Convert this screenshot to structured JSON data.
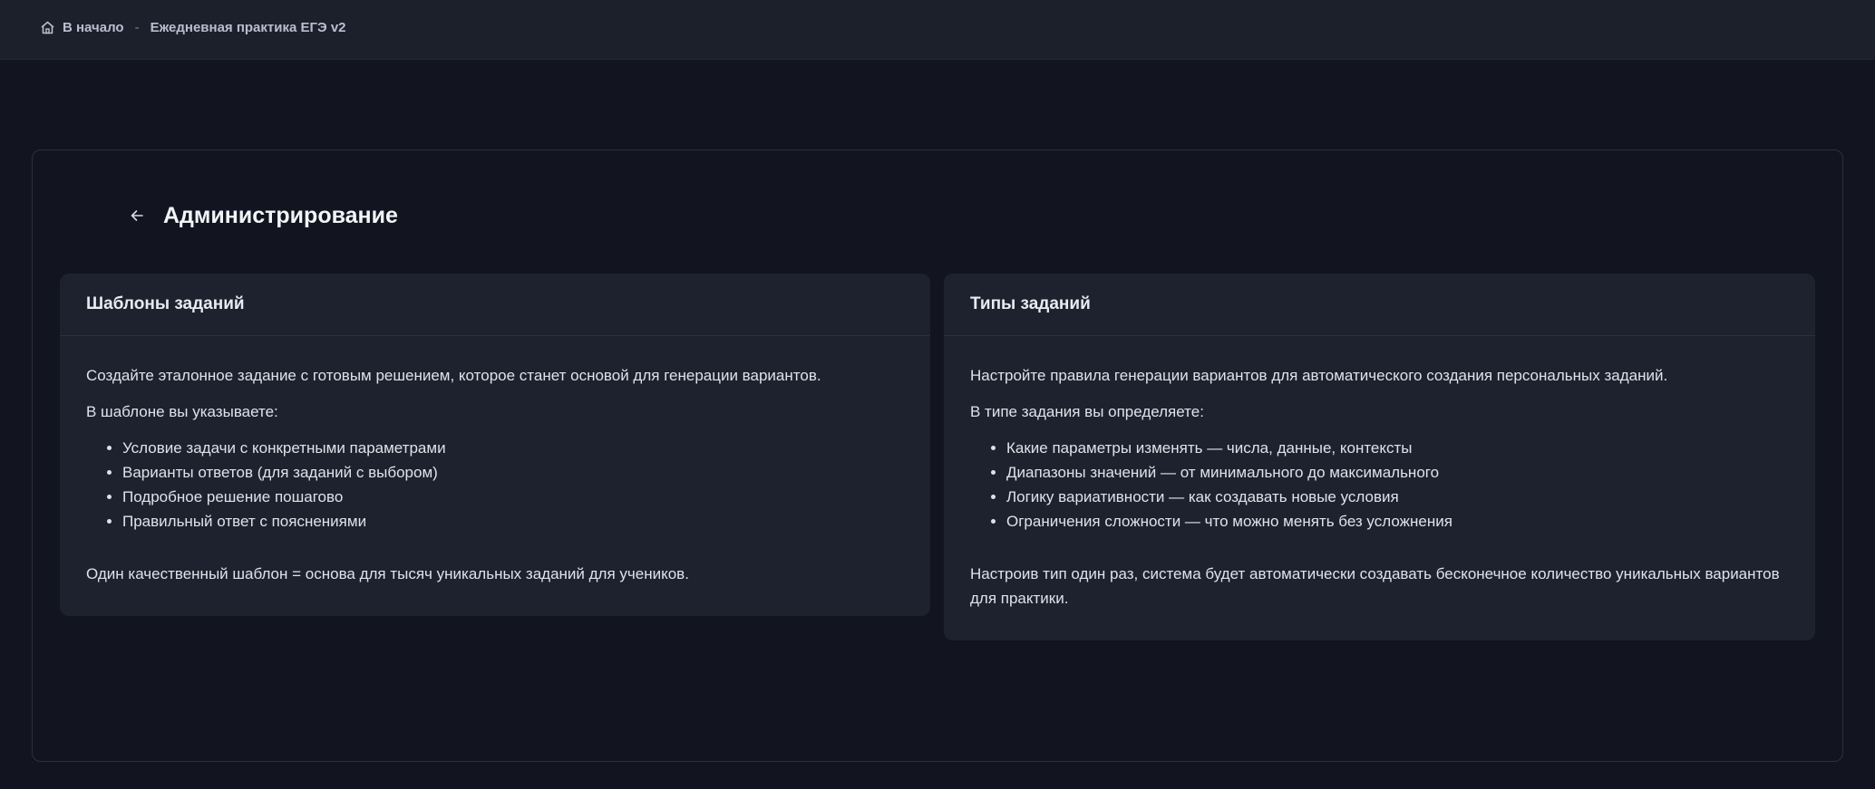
{
  "breadcrumb": {
    "home_label": "В начало",
    "separator": "-",
    "current": "Ежедневная практика ЕГЭ v2"
  },
  "page": {
    "title": "Администрирование"
  },
  "panels": {
    "templates": {
      "title": "Шаблоны заданий",
      "intro": "Создайте эталонное задание с готовым решением, которое станет основой для генерации вариантов.",
      "lead": "В шаблоне вы указываете:",
      "items": [
        "Условие задачи с конкретными параметрами",
        "Варианты ответов (для заданий с выбором)",
        "Подробное решение пошагово",
        "Правильный ответ с пояснениями"
      ],
      "summary": "Один качественный шаблон = основа для тысяч уникальных заданий для учеников."
    },
    "types": {
      "title": "Типы заданий",
      "intro": "Настройте правила генерации вариантов для автоматического создания персональных заданий.",
      "lead": "В типе задания вы определяете:",
      "items": [
        "Какие параметры изменять — числа, данные, контексты",
        "Диапазоны значений — от минимального до максимального",
        "Логику вариативности — как создавать новые условия",
        "Ограничения сложности — что можно менять без усложнения"
      ],
      "summary": "Настроив тип один раз, система будет автоматически создавать бесконечное количество уникальных вариантов для практики."
    }
  },
  "icons": {
    "home": "home-icon",
    "back": "arrow-left-icon"
  },
  "colors": {
    "background": "#12151f",
    "topbar": "#1c202b",
    "panel": "#1e222e",
    "border": "#2c3140"
  }
}
